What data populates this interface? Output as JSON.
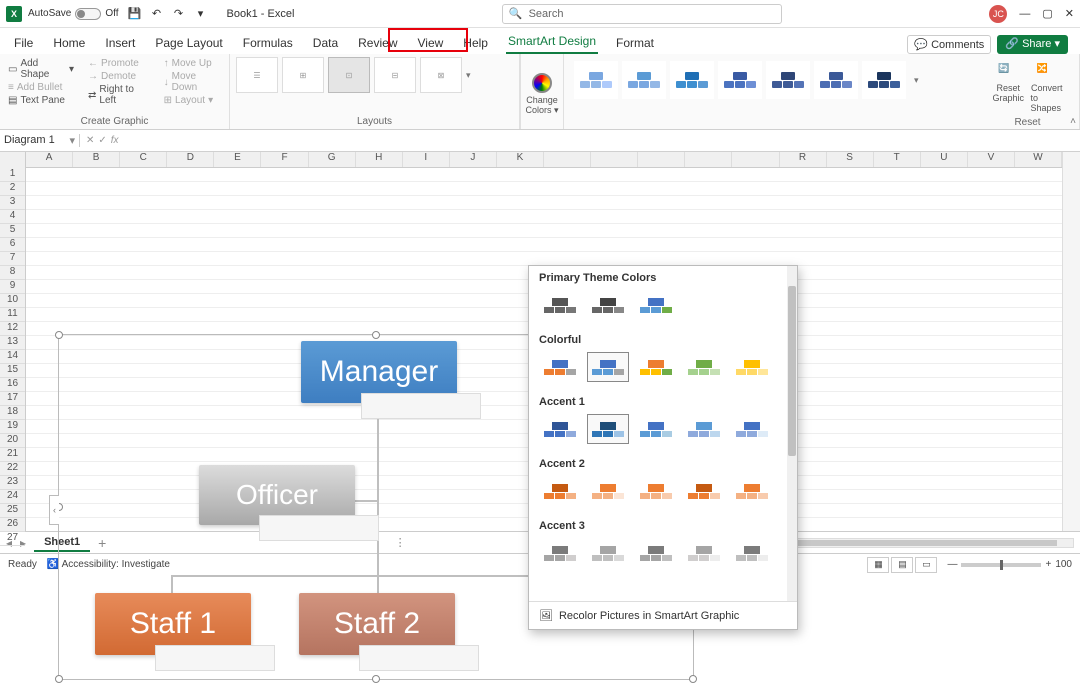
{
  "titlebar": {
    "autosave_label": "AutoSave",
    "autosave_state": "Off",
    "book_title": "Book1 - Excel",
    "search_placeholder": "Search",
    "user_initials": "JC"
  },
  "menubar": {
    "tabs": [
      "File",
      "Home",
      "Insert",
      "Page Layout",
      "Formulas",
      "Data",
      "Review",
      "View",
      "Help",
      "SmartArt Design",
      "Format"
    ],
    "active_tab": "SmartArt Design",
    "highlighted_tab": "SmartArt Design",
    "comments_label": "Comments",
    "share_label": "Share"
  },
  "ribbon": {
    "create_graphic": {
      "add_shape": "Add Shape",
      "add_bullet": "Add Bullet",
      "text_pane": "Text Pane",
      "promote": "Promote",
      "demote": "Demote",
      "right_to_left": "Right to Left",
      "move_up": "Move Up",
      "move_down": "Move Down",
      "layout": "Layout",
      "group_label": "Create Graphic"
    },
    "layouts": {
      "group_label": "Layouts"
    },
    "change_colors": {
      "label_line1": "Change",
      "label_line2": "Colors"
    },
    "reset": {
      "reset_graphic_line1": "Reset",
      "reset_graphic_line2": "Graphic",
      "convert_line1": "Convert",
      "convert_line2": "to Shapes",
      "group_label": "Reset"
    }
  },
  "namebox": {
    "value": "Diagram 1"
  },
  "columns": [
    "A",
    "B",
    "C",
    "D",
    "E",
    "F",
    "G",
    "H",
    "I",
    "J",
    "K",
    "",
    "",
    "",
    "",
    "",
    "R",
    "S",
    "T",
    "U",
    "V",
    "W"
  ],
  "rows_shown": 27,
  "smartart": {
    "nodes": {
      "manager": "Manager",
      "officer": "Officer",
      "staff1": "Staff 1",
      "staff2": "Staff 2"
    }
  },
  "color_panel": {
    "sections": [
      "Primary Theme Colors",
      "Colorful",
      "Accent 1",
      "Accent 2",
      "Accent 3"
    ],
    "footer": "Recolor Pictures in SmartArt Graphic",
    "section_palettes": {
      "Primary Theme Colors": [
        [
          "#555",
          "#666",
          "#777"
        ],
        [
          "#444",
          "#666",
          "#888"
        ],
        [
          "#4472c4",
          "#5b9bd5",
          "#70ad47"
        ]
      ],
      "Colorful": [
        [
          "#4472c4",
          "#ed7d31",
          "#a5a5a5"
        ],
        [
          "#4472c4",
          "#5b9bd5",
          "#a5a5a5"
        ],
        [
          "#ed7d31",
          "#ffc000",
          "#70ad47"
        ],
        [
          "#70ad47",
          "#a5d18e",
          "#c5e0b4"
        ],
        [
          "#ffc000",
          "#ffd966",
          "#ffe699"
        ]
      ],
      "Accent 1": [
        [
          "#2f5597",
          "#4472c4",
          "#8faadc"
        ],
        [
          "#1f4e79",
          "#2e75b6",
          "#9dc3e6"
        ],
        [
          "#4472c4",
          "#5b9bd5",
          "#a9cce3"
        ],
        [
          "#5b9bd5",
          "#8faadc",
          "#bdd7ee"
        ],
        [
          "#4472c4",
          "#8faadc",
          "#deebf7"
        ]
      ],
      "Accent 2": [
        [
          "#c55a11",
          "#ed7d31",
          "#f4b183"
        ],
        [
          "#ed7d31",
          "#f4b183",
          "#fbe5d6"
        ],
        [
          "#ed7d31",
          "#f4b183",
          "#f8cbad"
        ],
        [
          "#c55a11",
          "#ed7d31",
          "#f8cbad"
        ],
        [
          "#ed7d31",
          "#f4b183",
          "#f8cbad"
        ]
      ],
      "Accent 3": [
        [
          "#7b7b7b",
          "#a5a5a5",
          "#d0cece"
        ],
        [
          "#a5a5a5",
          "#bfbfbf",
          "#d9d9d9"
        ],
        [
          "#7b7b7b",
          "#a5a5a5",
          "#bfbfbf"
        ],
        [
          "#a5a5a5",
          "#d0cece",
          "#ededed"
        ],
        [
          "#7b7b7b",
          "#bfbfbf",
          "#ededed"
        ]
      ]
    }
  },
  "sheet": {
    "name": "Sheet1"
  },
  "statusbar": {
    "ready": "Ready",
    "accessibility": "Accessibility: Investigate",
    "zoom": "100"
  },
  "chart_data": {
    "type": "hierarchy",
    "title": "",
    "nodes": [
      {
        "id": "manager",
        "label": "Manager",
        "color": "#3e7ec1",
        "parent": null
      },
      {
        "id": "officer",
        "label": "Officer",
        "color": "#a8a8a8",
        "parent": "manager",
        "assistant": true
      },
      {
        "id": "staff1",
        "label": "Staff 1",
        "color": "#d26a33",
        "parent": "manager"
      },
      {
        "id": "staff2",
        "label": "Staff 2",
        "color": "#b57460",
        "parent": "manager"
      },
      {
        "id": "staff3",
        "label": "",
        "color": "#888",
        "parent": "manager"
      }
    ]
  },
  "colors": {
    "accent_green": "#107c41",
    "highlight_red": "#e7000b"
  }
}
